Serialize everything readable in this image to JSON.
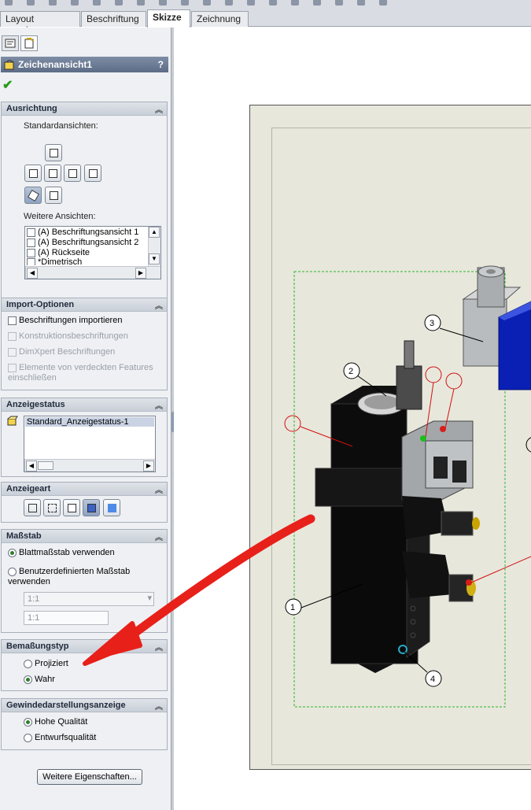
{
  "tabs": [
    "Layout anzeigen",
    "Beschriftung",
    "Skizze",
    "Zeichnung"
  ],
  "active_tab": "Skizze",
  "panel": {
    "title": "Zeichenansicht1",
    "help": "?",
    "ausrichtung": {
      "header": "Ausrichtung",
      "standard_label": "Standardansichten:",
      "weitere_label": "Weitere Ansichten:",
      "list_items": [
        "(A) Beschriftungsansicht 1",
        "(A) Beschriftungsansicht 2",
        "(A) Rückseite",
        "*Dimetrisch"
      ]
    },
    "import": {
      "header": "Import-Optionen",
      "items": [
        "Beschriftungen importieren",
        "Konstruktionsbeschriftungen",
        "DimXpert Beschriftungen",
        "Elemente von verdeckten Features einschließen"
      ]
    },
    "anzeigestatus": {
      "header": "Anzeigestatus",
      "item": "Standard_Anzeigestatus-1"
    },
    "anzeigeart": {
      "header": "Anzeigeart"
    },
    "massstab": {
      "header": "Maßstab",
      "opt1": "Blattmaßstab verwenden",
      "opt2": "Benutzerdefinierten Maßstab verwenden",
      "combo": "1:1",
      "field": "1:1"
    },
    "bemassung": {
      "header": "Bemaßungstyp",
      "opt1": "Projiziert",
      "opt2": "Wahr"
    },
    "gewinde": {
      "header": "Gewindedarstellungsanzeige",
      "opt1": "Hohe Qualität",
      "opt2": "Entwurfsqualität"
    },
    "more_button": "Weitere Eigenschaften..."
  },
  "balloons": [
    "1",
    "2",
    "3",
    "4"
  ],
  "colors": {
    "accent_arrow": "#e8201a",
    "part_body": "#111111",
    "sheet": "#e8e7dc"
  }
}
